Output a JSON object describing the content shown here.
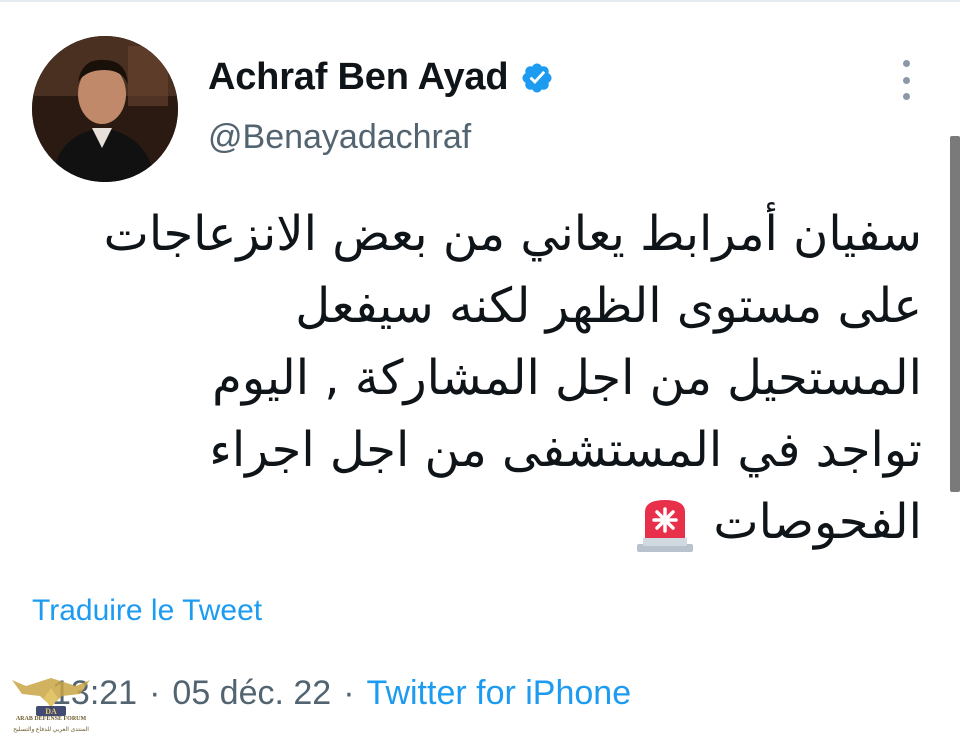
{
  "user": {
    "display_name": "Achraf Ben Ayad",
    "handle": "@Benayadachraf",
    "verified": true,
    "avatar_icon": "profile-photo"
  },
  "tweet": {
    "lines": [
      "سفيان أمرابط يعاني من بعض الانزعاجات",
      "على مستوى الظهر لكنه سيفعل",
      "المستحيل من اجل المشاركة , اليوم",
      "تواجد في المستشفى من اجل اجراء",
      "الفحوصات"
    ],
    "emoji": "police-light-icon"
  },
  "actions": {
    "translate_label": "Traduire le Tweet",
    "more_icon": "more-vertical-icon"
  },
  "meta": {
    "time": "13:21",
    "separator": "·",
    "date": "05 déc. 22",
    "source": "Twitter for iPhone"
  },
  "watermark": {
    "line1": "ARAB DEFENSE FORUM",
    "line2": "المنتدى العربي للدفاع والتسليح",
    "badge": "DA"
  },
  "colors": {
    "link": "#1d9bf0",
    "secondary_text": "#536471",
    "verified": "#1d9bf0",
    "alarm": "#e8304a"
  }
}
